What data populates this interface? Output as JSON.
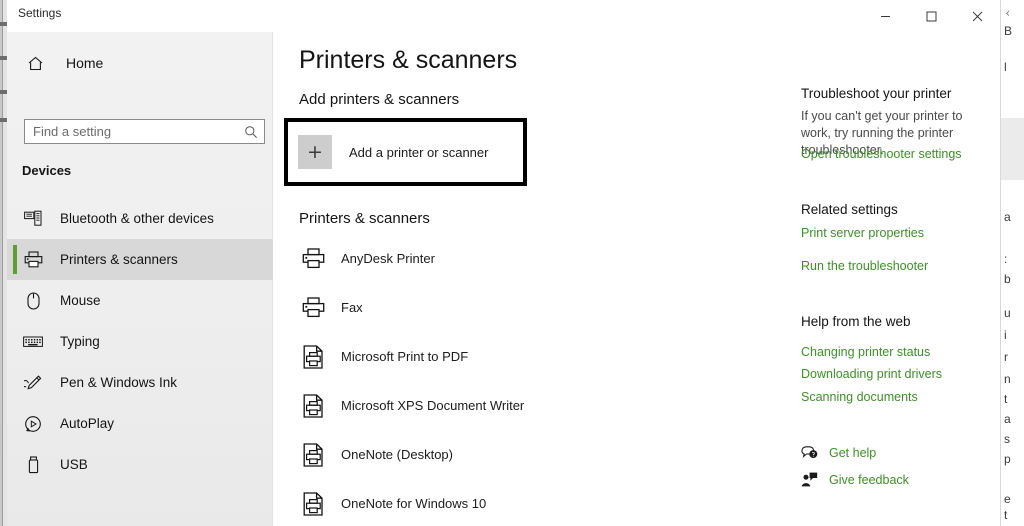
{
  "window": {
    "caption": "Settings",
    "controls": {
      "minimize_label": "Minimize",
      "maximize_label": "Maximize",
      "close_label": "Close"
    }
  },
  "nav": {
    "home_label": "Home",
    "home_icon": "home-icon",
    "search": {
      "placeholder": "Find a setting",
      "value": "",
      "icon": "search-icon"
    },
    "group_title": "Devices",
    "items": [
      {
        "label": "Bluetooth & other devices",
        "icon": "bluetooth-devices-icon",
        "selected": false
      },
      {
        "label": "Printers & scanners",
        "icon": "printer-icon",
        "selected": true
      },
      {
        "label": "Mouse",
        "icon": "mouse-icon",
        "selected": false
      },
      {
        "label": "Typing",
        "icon": "keyboard-icon",
        "selected": false
      },
      {
        "label": "Pen & Windows Ink",
        "icon": "pen-icon",
        "selected": false
      },
      {
        "label": "AutoPlay",
        "icon": "autoplay-icon",
        "selected": false
      },
      {
        "label": "USB",
        "icon": "usb-icon",
        "selected": false
      }
    ]
  },
  "main": {
    "page_title": "Printers & scanners",
    "add_section_title": "Add printers & scanners",
    "add_button": {
      "label": "Add a printer or scanner",
      "icon": "plus-icon",
      "highlighted": true
    },
    "list_section_title": "Printers & scanners",
    "printers": [
      {
        "name": "AnyDesk Printer",
        "icon": "printer-icon"
      },
      {
        "name": "Fax",
        "icon": "printer-icon"
      },
      {
        "name": "Microsoft Print to PDF",
        "icon": "document-printer-icon"
      },
      {
        "name": "Microsoft XPS Document Writer",
        "icon": "document-printer-icon"
      },
      {
        "name": "OneNote (Desktop)",
        "icon": "document-printer-icon"
      },
      {
        "name": "OneNote for Windows 10",
        "icon": "document-printer-icon"
      }
    ]
  },
  "aside": {
    "troubleshoot": {
      "title": "Troubleshoot your printer",
      "body": "If you can't get your printer to work, try running the printer troubleshooter.",
      "link": "Open troubleshooter settings"
    },
    "related": {
      "title": "Related settings",
      "links": [
        "Print server properties",
        "Run the troubleshooter"
      ]
    },
    "help_web": {
      "title": "Help from the web",
      "links": [
        "Changing printer status",
        "Downloading print drivers",
        "Scanning documents"
      ]
    },
    "support": [
      {
        "label": "Get help",
        "icon": "help-bubble-icon"
      },
      {
        "label": "Give feedback",
        "icon": "feedback-person-icon"
      }
    ]
  },
  "theme": {
    "accent": "#5c9e2f",
    "link": "#3f8f29",
    "selected_bg": "#d8d8d8",
    "nav_bg": "#f0f0f0",
    "highlight_border": "#000000"
  }
}
